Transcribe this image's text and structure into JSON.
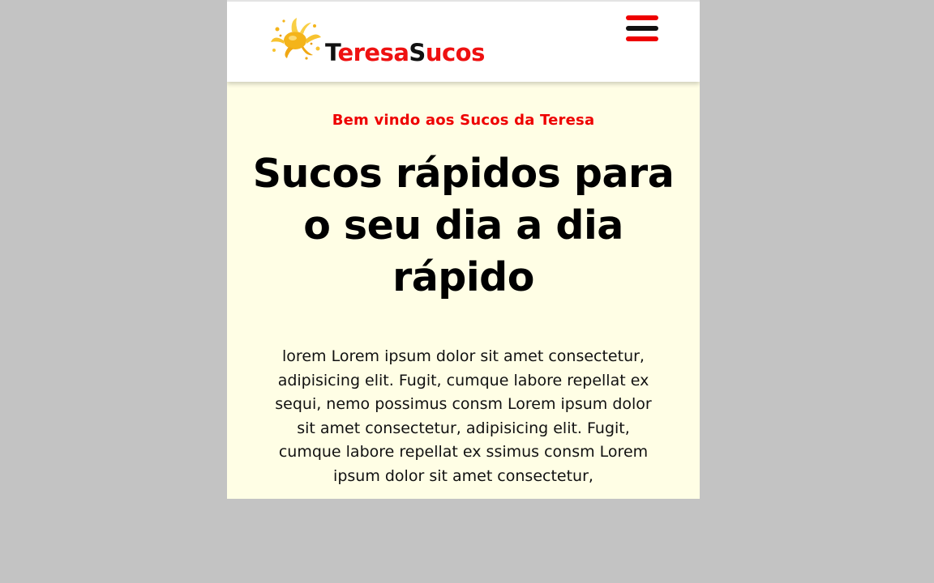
{
  "header": {
    "logo_text_part1": "Teresa",
    "logo_text_part2": "Sucos",
    "logo_splash": "juice-splash-icon",
    "menu_icon": "hamburger-menu-icon"
  },
  "hero": {
    "welcome": "Bem vindo aos Sucos da Teresa",
    "headline": "Sucos rápidos para o seu dia a dia rápido",
    "body": "lorem Lorem ipsum dolor sit amet consectetur, adipisicing elit. Fugit, cumque labore repellat ex sequi, nemo possimus consm Lorem ipsum dolor sit amet consectetur, adipisicing elit. Fugit, cumque labore repellat ex ssimus consm Lorem ipsum dolor sit amet consectetur,"
  },
  "colors": {
    "page_background": "#c3c3c3",
    "content_background": "#fffee5",
    "accent_red": "#ee0000",
    "text_black": "#000000"
  }
}
